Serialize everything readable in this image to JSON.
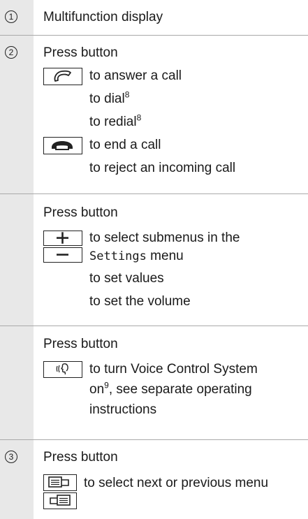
{
  "rows": [
    {
      "number": "1",
      "title": "Multifunction display"
    },
    {
      "number": "2",
      "title": "Press button",
      "items": [
        {
          "button": "phone-answer-icon",
          "text": "to answer a call"
        },
        {
          "text": "to dial",
          "footnote": "8"
        },
        {
          "text": "to redial",
          "footnote": "8"
        },
        {
          "button": "phone-hangup-icon",
          "text": "to end a call"
        },
        {
          "text": "to reject an incoming call"
        }
      ]
    },
    {
      "title": "Press button",
      "items": [
        {
          "button": "plus-icon",
          "text": "to select submenus in the"
        },
        {
          "button": "minus-icon",
          "mono": "Settings",
          "text": "menu"
        },
        {
          "text": "to set values"
        },
        {
          "text": "to set the volume"
        }
      ]
    },
    {
      "title": "Press button",
      "items": [
        {
          "button": "voice-control-icon",
          "text": "to turn Voice Control System"
        },
        {
          "text_pre": "on",
          "footnote": "9",
          "text": ", see separate operating"
        },
        {
          "text": "instructions"
        }
      ]
    },
    {
      "number": "3",
      "title": "Press button",
      "items": [
        {
          "button": "menu-next-icon",
          "text": "to select next or previous menu"
        },
        {
          "button": "menu-previous-icon"
        }
      ]
    }
  ]
}
